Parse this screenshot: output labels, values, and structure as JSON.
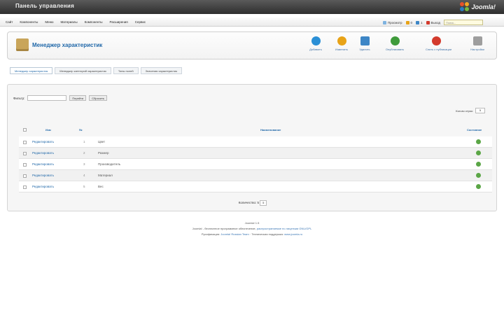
{
  "window": {
    "title": "Панель управления",
    "logo_text": "Joomla!"
  },
  "menu": [
    "Сайт",
    "Компоненты",
    "Меню",
    "Материалы",
    "Компоненты",
    "Расширения",
    "Сервис"
  ],
  "status": {
    "items": [
      "Просмотр",
      "0",
      "1",
      "Выход"
    ],
    "search_placeholder": "Поиск..."
  },
  "toolbar": {
    "page_title": "Менеджер характеристик",
    "buttons": [
      {
        "label": "Добавить",
        "color": "#2a8fd6"
      },
      {
        "label": "Изменить",
        "color": "#e8a317"
      },
      {
        "label": "Удалить",
        "color": "#3d86c6"
      },
      {
        "label": "Опубликовать",
        "color": "#3f9b3b"
      },
      {
        "label": "Снять с публикации",
        "color": "#d33a2c"
      },
      {
        "label": "Настройки",
        "color": "#9e9e9e"
      }
    ]
  },
  "tabs": [
    "Менеджер характеристик",
    "Менеджер категорий характеристик",
    "Типы полей",
    "Значения характеристик"
  ],
  "filter": {
    "label": "Фильтр:",
    "go": "Перейти",
    "reset": "Сбросить"
  },
  "display": {
    "label": "Кол-во строк:",
    "value": "5"
  },
  "table": {
    "headers": [
      "Изм",
      "№",
      "Наименование",
      "Состояние"
    ],
    "rows": [
      {
        "edit": "Редактировать",
        "num": "1",
        "name": "Цвет"
      },
      {
        "edit": "Редактировать",
        "num": "2",
        "name": "Размер"
      },
      {
        "edit": "Редактировать",
        "num": "3",
        "name": "Производитель"
      },
      {
        "edit": "Редактировать",
        "num": "4",
        "name": "Материал"
      },
      {
        "edit": "Редактировать",
        "num": "5",
        "name": "Вес"
      }
    ]
  },
  "pagination": {
    "label": "Количество: 5",
    "value": "5"
  },
  "footer": {
    "version": "Joomla! 1.5",
    "line1_prefix": "Joomla! - бесплатное программное обеспечение,",
    "line1_link": "распространяемое по лицензии GNU/GPL",
    "line2_prefix": "Русификация:",
    "line2_link1": "Joomla! Russian Team",
    "line2_mid": "· Техническая поддержка:",
    "line2_link2": "www.joomla.ru"
  }
}
